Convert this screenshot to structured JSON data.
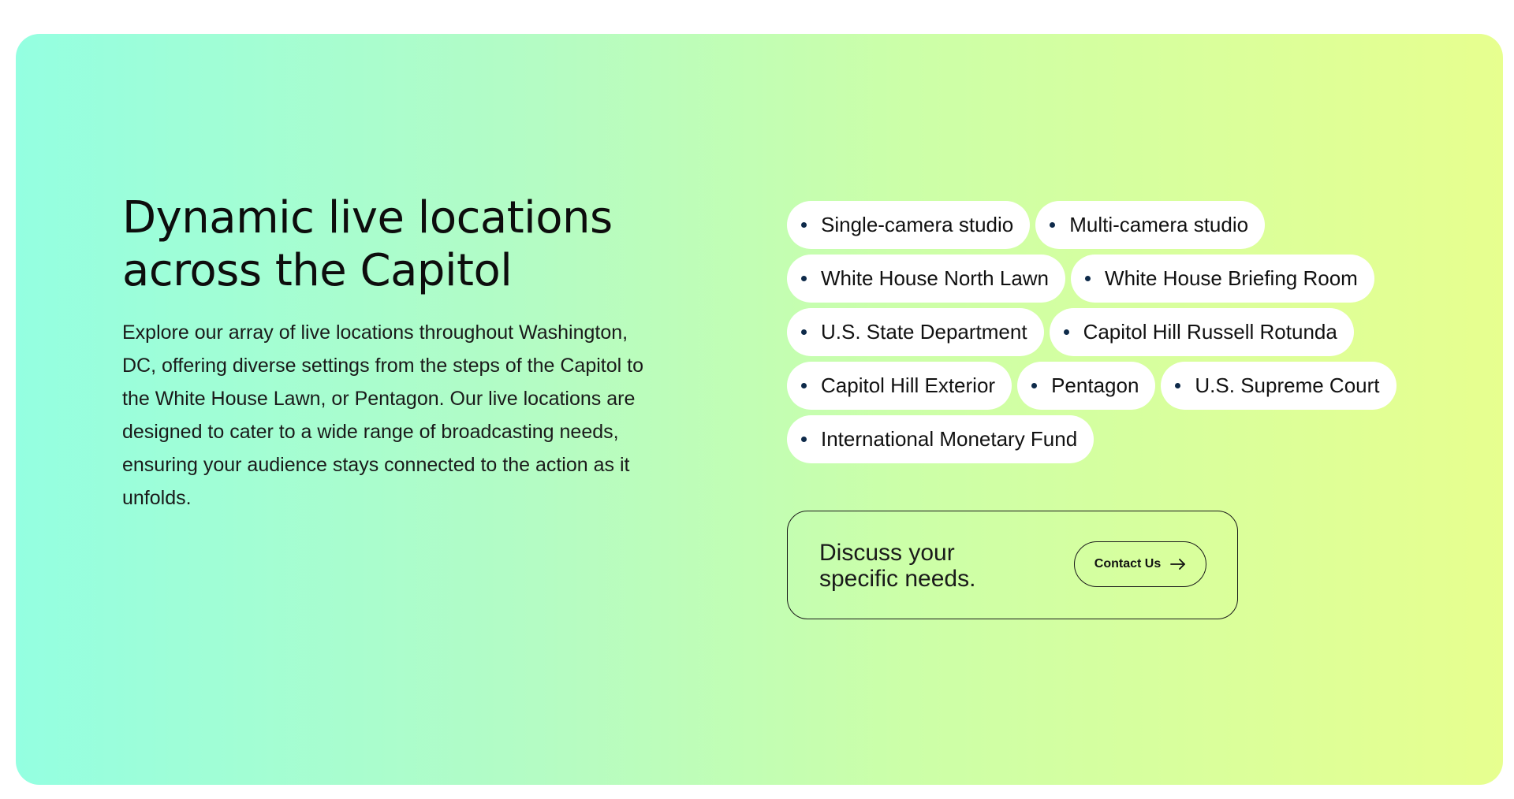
{
  "section": {
    "title_line1": "Dynamic live locations",
    "title_line2": "across the Capitol",
    "description": "Explore our array of live locations throughout Washington, DC, offering diverse settings from the steps of the Capitol to the White House Lawn, or Pentagon. Our live locations are designed to cater to a wide range of broadcasting needs, ensuring your audience stays connected to the action as it unfolds."
  },
  "locations": [
    "Single-camera studio",
    "Multi-camera studio",
    "White House North Lawn",
    "White House Briefing Room",
    "U.S. State Department",
    "Capitol Hill Russell Rotunda",
    "Capitol Hill Exterior",
    "Pentagon",
    "U.S. Supreme Court",
    "International Monetary Fund"
  ],
  "cta": {
    "text_line1": "Discuss your",
    "text_line2": "specific needs.",
    "button_label": "Contact Us",
    "button_icon": "arrow-right-icon"
  },
  "colors": {
    "gradient_start": "#94ffe1",
    "gradient_end": "#e7ff8f",
    "tag_background": "#ffffff",
    "bullet": "#0e2a4a"
  }
}
